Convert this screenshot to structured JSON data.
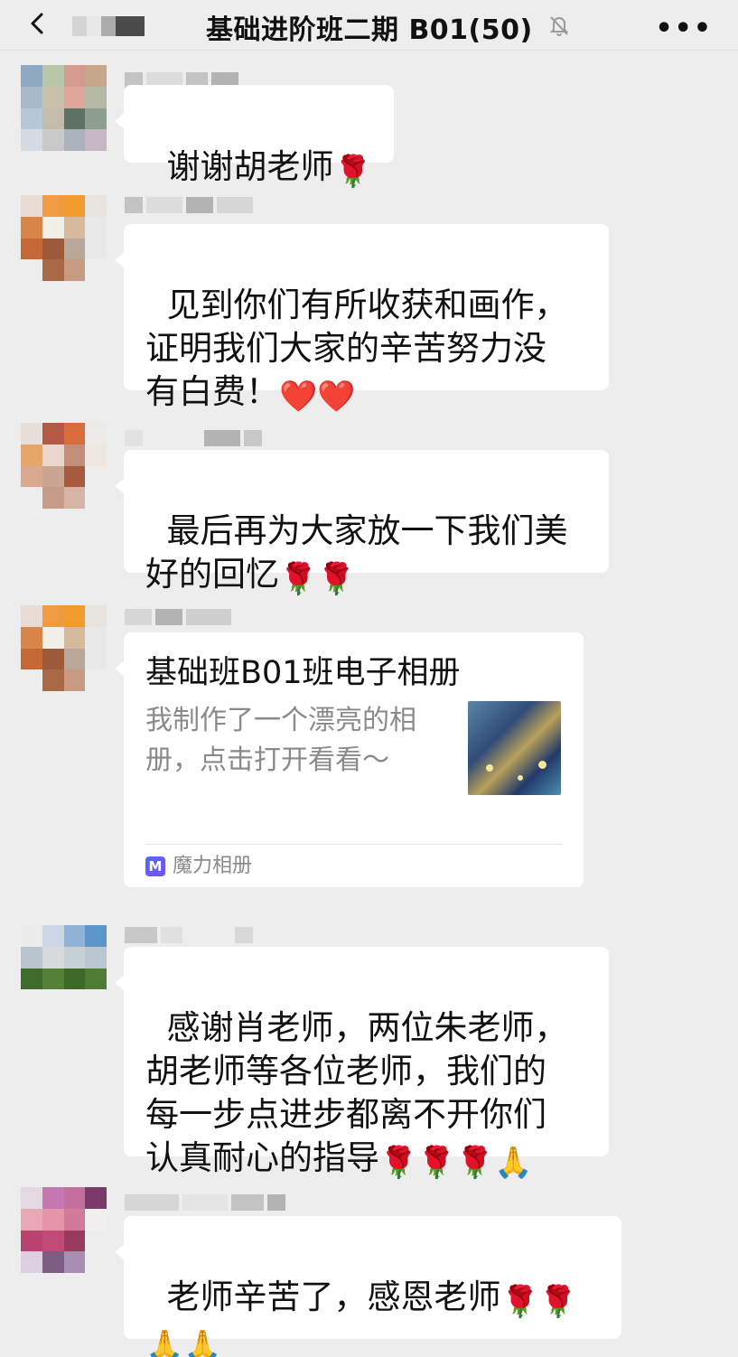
{
  "header": {
    "title": "基础进阶班二期 B01(50)",
    "back_icon": "chevron-left-icon",
    "mute_icon": "bell-slash-icon",
    "more_label": "•••"
  },
  "messages": [
    {
      "text": "谢谢胡老师",
      "emoji": "🌹"
    },
    {
      "text": "见到你们有所收获和画作，\n证明我们大家的辛苦努力没\n有白费！",
      "emoji": "❤️❤️"
    },
    {
      "text": "最后再为大家放一下我们美\n好的回忆",
      "emoji": "🌹🌹"
    },
    {
      "text": "感谢肖老师，两位朱老师，\n胡老师等各位老师，我们的\n每一步点进步都离不开你们\n认真耐心的指导",
      "emoji": "🌹🌹🌹🙏"
    },
    {
      "text": "老师辛苦了，感恩老师",
      "emoji": "🌹🌹",
      "emoji2": "🙏🙏"
    }
  ],
  "card": {
    "title": "基础班B01班电子相册",
    "description": "我制作了一个漂亮的相册，点击打开看看～",
    "source": "魔力相册",
    "source_icon_letter": "M"
  },
  "colors": {
    "background": "#ededed",
    "bubble": "#ffffff",
    "muted_text": "#8a8a8a"
  }
}
